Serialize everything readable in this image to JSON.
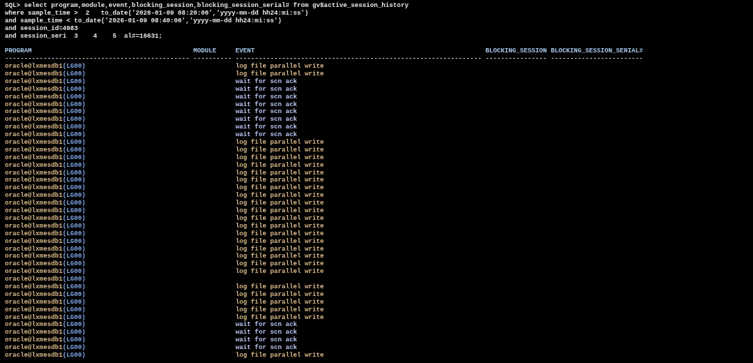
{
  "sql_lines": [
    "SQL> select program,module,event,blocking_session,blocking_session_serial# from gv$active_session_history",
    "where sample_time >  2   to_date('2026-01-09 08:20:00','yyyy-mm-dd hh24:mi:ss')",
    "and sample_time < to_date('2026-01-09 08:40:00','yyyy-mm-dd hh24:mi:ss')",
    "and session_id=4983",
    "and session_seri  3    4    5  al#=16631;"
  ],
  "columns": [
    {
      "label": "PROGRAM",
      "underline": "------------------------------------------------"
    },
    {
      "label": "MODULE",
      "underline": "----------"
    },
    {
      "label": "EVENT",
      "underline": "----------------------------------------------------------------"
    },
    {
      "label": "BLOCKING_SESSION",
      "underline": "----------------"
    },
    {
      "label": "BLOCKING_SESSION_SERIAL#",
      "underline": "------------------------"
    }
  ],
  "rows": [
    {
      "program": "oracle@lxmesdb1",
      "process": "(LG00)",
      "event": "log file parallel write",
      "color": "#d9b98a"
    },
    {
      "program": "oracle@lxmesdb1",
      "process": "(LG00)",
      "event": "log file parallel write",
      "color": "#d9b98a"
    },
    {
      "program": "oracle@lxmesdb1",
      "process": "(LG00)",
      "event": "wait for scn ack",
      "color": "#b9c3f0"
    },
    {
      "program": "oracle@lxmesdb1",
      "process": "(LG00)",
      "event": "wait for scn ack",
      "color": "#b9c3f0"
    },
    {
      "program": "oracle@lxmesdb1",
      "process": "(LG00)",
      "event": "wait for scn ack",
      "color": "#b9c3f0"
    },
    {
      "program": "oracle@lxmesdb1",
      "process": "(LG00)",
      "event": "wait for scn ack",
      "color": "#b9c3f0"
    },
    {
      "program": "oracle@lxmesdb1",
      "process": "(LG00)",
      "event": "wait for scn ack",
      "color": "#b9c3f0"
    },
    {
      "program": "oracle@lxmesdb1",
      "process": "(LG00)",
      "event": "wait for scn ack",
      "color": "#b9c3f0"
    },
    {
      "program": "oracle@lxmesdb1",
      "process": "(LG00)",
      "event": "wait for scn ack",
      "color": "#b9c3f0"
    },
    {
      "program": "oracle@lxmesdb1",
      "process": "(LG00)",
      "event": "wait for scn ack",
      "color": "#b9c3f0"
    },
    {
      "program": "oracle@lxmesdb1",
      "process": "(LG00)",
      "event": "log file parallel write",
      "color": "#d9b98a"
    },
    {
      "program": "oracle@lxmesdb1",
      "process": "(LG00)",
      "event": "log file parallel write",
      "color": "#d9b98a"
    },
    {
      "program": "oracle@lxmesdb1",
      "process": "(LG00)",
      "event": "log file parallel write",
      "color": "#d9b98a"
    },
    {
      "program": "oracle@lxmesdb1",
      "process": "(LG00)",
      "event": "log file parallel write",
      "color": "#d9b98a"
    },
    {
      "program": "oracle@lxmesdb1",
      "process": "(LG00)",
      "event": "log file parallel write",
      "color": "#d9b98a"
    },
    {
      "program": "oracle@lxmesdb1",
      "process": "(LG00)",
      "event": "log file parallel write",
      "color": "#d9b98a"
    },
    {
      "program": "oracle@lxmesdb1",
      "process": "(LG00)",
      "event": "log file parallel write",
      "color": "#d9b98a"
    },
    {
      "program": "oracle@lxmesdb1",
      "process": "(LG00)",
      "event": "log file parallel write",
      "color": "#d9b98a"
    },
    {
      "program": "oracle@lxmesdb1",
      "process": "(LG00)",
      "event": "log file parallel write",
      "color": "#d9b98a"
    },
    {
      "program": "oracle@lxmesdb1",
      "process": "(LG00)",
      "event": "log file parallel write",
      "color": "#d9b98a"
    },
    {
      "program": "oracle@lxmesdb1",
      "process": "(LG00)",
      "event": "log file parallel write",
      "color": "#d9b98a"
    },
    {
      "program": "oracle@lxmesdb1",
      "process": "(LG00)",
      "event": "log file parallel write",
      "color": "#d9b98a"
    },
    {
      "program": "oracle@lxmesdb1",
      "process": "(LG00)",
      "event": "log file parallel write",
      "color": "#d9b98a"
    },
    {
      "program": "oracle@lxmesdb1",
      "process": "(LG00)",
      "event": "log file parallel write",
      "color": "#d9b98a"
    },
    {
      "program": "oracle@lxmesdb1",
      "process": "(LG00)",
      "event": "log file parallel write",
      "color": "#d9b98a"
    },
    {
      "program": "oracle@lxmesdb1",
      "process": "(LG00)",
      "event": "log file parallel write",
      "color": "#d9b98a"
    },
    {
      "program": "oracle@lxmesdb1",
      "process": "(LG00)",
      "event": "log file parallel write",
      "color": "#d9b98a"
    },
    {
      "program": "oracle@lxmesdb1",
      "process": "(LG00)",
      "event": "log file parallel write",
      "color": "#d9b98a"
    },
    {
      "program": "oracle@lxmesdb1",
      "process": "(LG00)"
    },
    {
      "program": "oracle@lxmesdb1",
      "process": "(LG00)",
      "event": "log file parallel write",
      "color": "#d9b98a"
    },
    {
      "program": "oracle@lxmesdb1",
      "process": "(LG00)",
      "event": "log file parallel write",
      "color": "#d9b98a"
    },
    {
      "program": "oracle@lxmesdb1",
      "process": "(LG00)",
      "event": "log file parallel write",
      "color": "#d9b98a"
    },
    {
      "program": "oracle@lxmesdb1",
      "process": "(LG00)",
      "event": "log file parallel write",
      "color": "#d9b98a"
    },
    {
      "program": "oracle@lxmesdb1",
      "process": "(LG00)",
      "event": "log file parallel write",
      "color": "#d9b98a"
    },
    {
      "program": "oracle@lxmesdb1",
      "process": "(LG00)",
      "event": "wait for scn ack",
      "color": "#b9c3f0"
    },
    {
      "program": "oracle@lxmesdb1",
      "process": "(LG00)",
      "event": "wait for scn ack",
      "color": "#b9c3f0"
    },
    {
      "program": "oracle@lxmesdb1",
      "process": "(LG00)",
      "event": "wait for scn ack",
      "color": "#b9c3f0"
    },
    {
      "program": "oracle@lxmesdb1",
      "process": "(LG00)",
      "event": "wait for scn ack",
      "color": "#b9c3f0"
    },
    {
      "program": "oracle@lxmesdb1",
      "process": "(LG00)",
      "event": "log file parallel write",
      "color": "#d9b98a"
    }
  ]
}
